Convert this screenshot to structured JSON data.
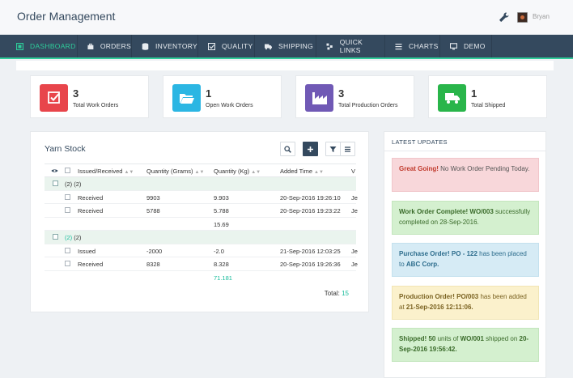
{
  "header": {
    "title": "Order Management",
    "username": "Bryan"
  },
  "nav": [
    {
      "label": "DASHBOARD",
      "icon": "dashboard-icon",
      "active": true
    },
    {
      "label": "ORDERS",
      "icon": "briefcase-icon"
    },
    {
      "label": "INVENTORY",
      "icon": "database-icon"
    },
    {
      "label": "QUALITY",
      "icon": "checkbox-icon"
    },
    {
      "label": "SHIPPING",
      "icon": "truck-icon"
    },
    {
      "label": "QUICK LINKS",
      "icon": "cubes-icon"
    },
    {
      "label": "CHARTS",
      "icon": "bars-icon"
    },
    {
      "label": "DEMO",
      "icon": "monitor-icon"
    }
  ],
  "stats": [
    {
      "value": "3",
      "label": "Total Work Orders",
      "color": "#e8454b",
      "icon": "checklist-icon"
    },
    {
      "value": "1",
      "label": "Open Work Orders",
      "color": "#2bb6e3",
      "icon": "folder-open-icon"
    },
    {
      "value": "3",
      "label": "Total Production Orders",
      "color": "#7059b5",
      "icon": "factory-icon"
    },
    {
      "value": "1",
      "label": "Total Shipped",
      "color": "#29b54a",
      "icon": "truck-icon"
    }
  ],
  "yarn": {
    "title": "Yarn Stock",
    "columns": [
      "Issued/Received",
      "Quantity (Grams)",
      "Quantity (Kg)",
      "Added Time",
      "V"
    ],
    "group1": {
      "label": "(2) (2)",
      "rows": [
        {
          "type": "Received",
          "grams": "9903",
          "kg": "9.903",
          "time": "20-Sep-2016 19:26:10",
          "v": "Je"
        },
        {
          "type": "Received",
          "grams": "5788",
          "kg": "5.788",
          "time": "20-Sep-2016 19:23:22",
          "v": "Je"
        }
      ],
      "sum": "15.69"
    },
    "group2": {
      "label_count": "(2)",
      "label_rest": "(2)",
      "rows": [
        {
          "type": "Issued",
          "grams": "-2000",
          "kg": "-2.0",
          "time": "21-Sep-2016 12:03:25",
          "v": "Je"
        },
        {
          "type": "Received",
          "grams": "8328",
          "kg": "8.328",
          "time": "20-Sep-2016 19:26:36",
          "v": "Je"
        }
      ],
      "sum": "71.181"
    },
    "total_label": "Total:",
    "total_value": "15"
  },
  "updates": {
    "title": "LATEST UPDATES",
    "items": [
      {
        "bold": "Great Going!",
        "text": " No Work Order Pending Today."
      },
      {
        "bold": "Work Order Complete! WO/003",
        "text": " successfully completed on 28-Sep-2016."
      },
      {
        "bold": "Purchase Order! PO - 122",
        "text": " has been placed to ",
        "bold2": "ABC Corp."
      },
      {
        "bold": "Production Order! PO/003",
        "text": " has been added at ",
        "bold2": "21-Sep-2016 12:11:06."
      },
      {
        "bold": "Shipped! 50",
        "text": " units of ",
        "bold2": "WO/001",
        "text2": " shipped on ",
        "bold3": "20-Sep-2016 19:56:42."
      }
    ]
  }
}
